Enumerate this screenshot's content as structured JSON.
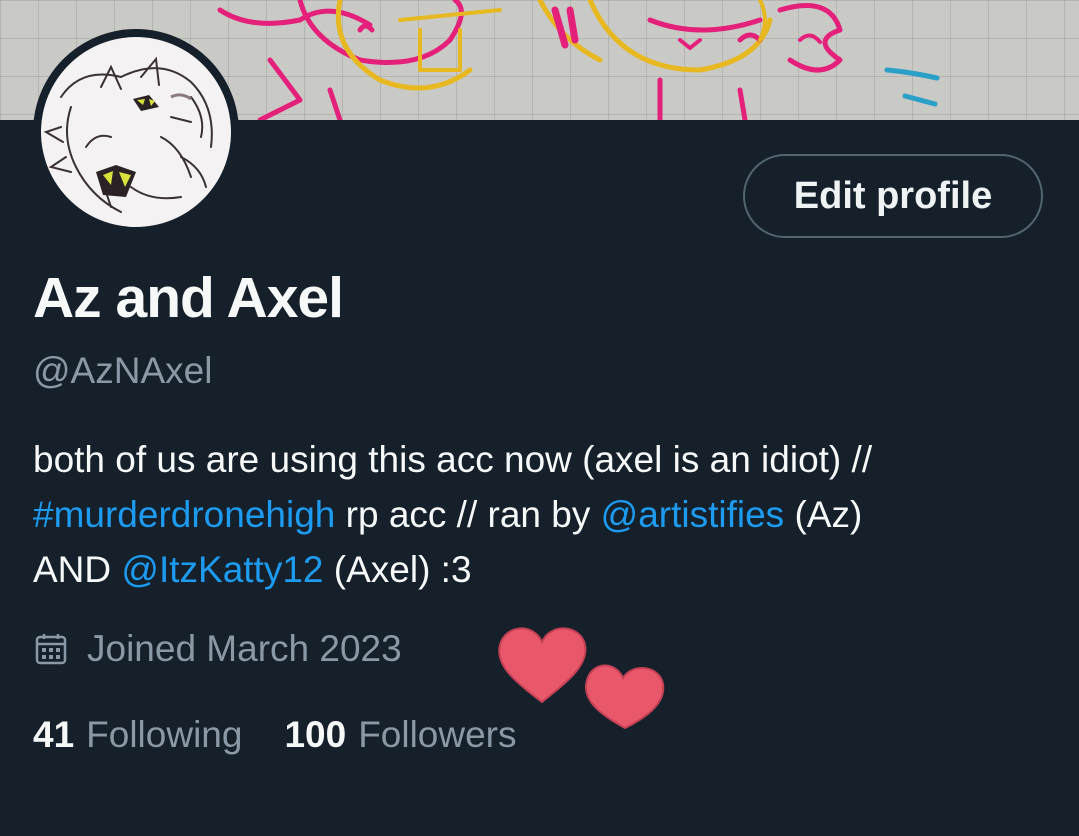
{
  "profile": {
    "display_name": "Az and Axel",
    "handle": "@AzNAxel",
    "edit_button_label": "Edit profile",
    "bio": {
      "line1": "both of us are using this acc now (axel is an idiot) //",
      "hashtag": "#murderdronehigh",
      "mid1": " rp acc // ran by ",
      "mention1": "@artistifies",
      "mid2": " (Az)",
      "prefix3": "AND ",
      "mention2": "@ItzKatty12",
      "suffix3": " (Axel) :3"
    },
    "joined_text": "Joined March 2023",
    "following_count": "41",
    "following_label": "Following",
    "followers_count": "100",
    "followers_label": "Followers"
  },
  "icons": {
    "calendar": "calendar-icon",
    "hearts": "heart-stickers"
  },
  "colors": {
    "background": "#15202b",
    "accent_link": "#1d9bf0",
    "secondary_text": "#8b98a5",
    "heart": "#e8586a"
  }
}
